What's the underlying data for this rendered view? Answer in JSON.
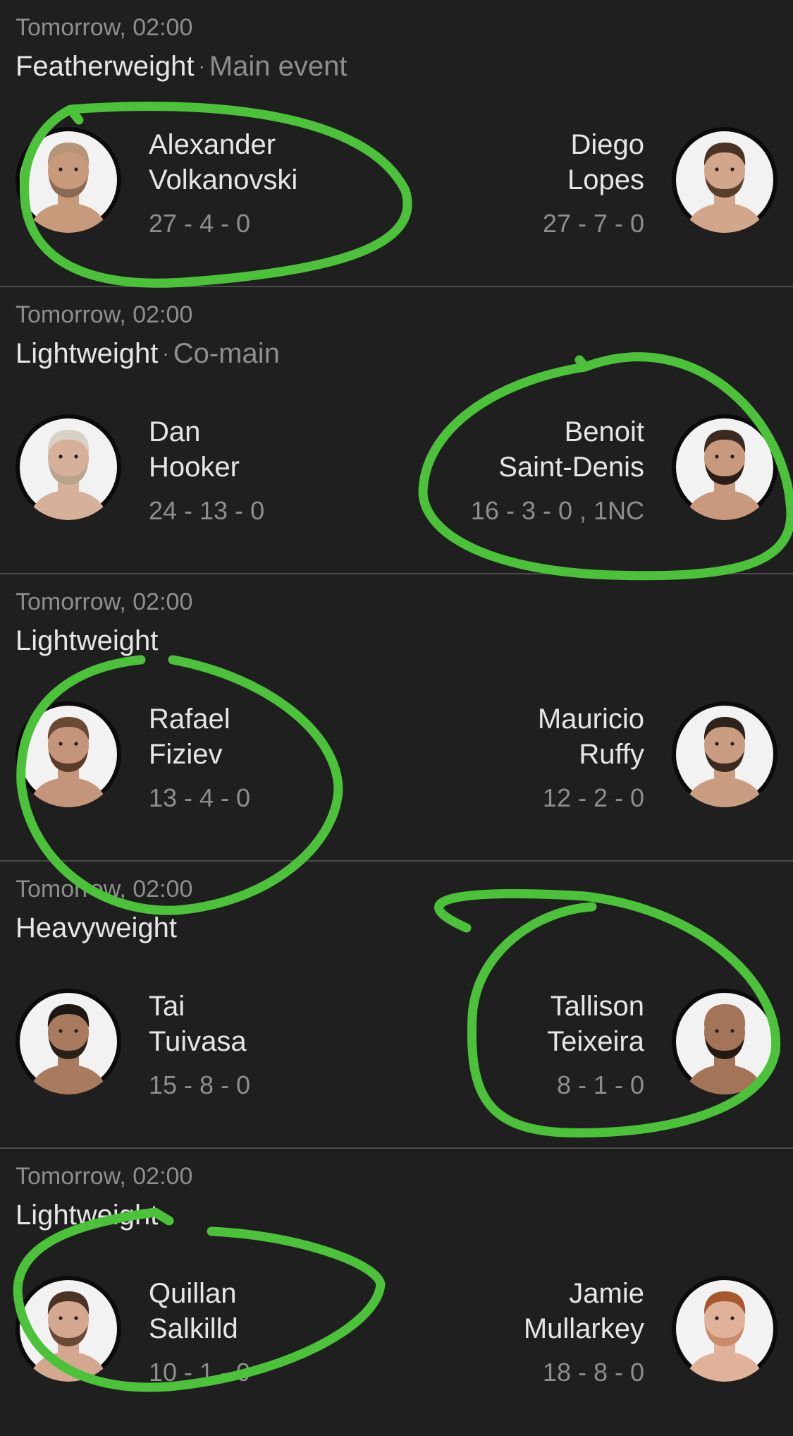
{
  "fights": [
    {
      "time": "Tomorrow, 02:00",
      "weight_class": "Featherweight",
      "separator": "·",
      "event_tag": "Main event",
      "left": {
        "first_name": "Alexander",
        "last_name": "Volkanovski",
        "record": "27 - 4 - 0",
        "skin": "#c89a7c",
        "hair": "#b59479",
        "beard": "#8a6a55"
      },
      "right": {
        "first_name": "Diego",
        "last_name": "Lopes",
        "record": "27 - 7 - 0",
        "skin": "#d2a68a",
        "hair": "#4a3325",
        "beard": "#5a3e2c"
      }
    },
    {
      "time": "Tomorrow, 02:00",
      "weight_class": "Lightweight",
      "separator": "·",
      "event_tag": "Co-main",
      "left": {
        "first_name": "Dan",
        "last_name": "Hooker",
        "record": "24 - 13 - 0",
        "skin": "#d6b09a",
        "hair": "#d8d2c6",
        "beard": "#b8a48c"
      },
      "right": {
        "first_name": "Benoit",
        "last_name": "Saint-Denis",
        "record": "16 - 3 - 0 , 1NC",
        "skin": "#c8997c",
        "hair": "#3a2a20",
        "beard": "#2a1e18"
      }
    },
    {
      "time": "Tomorrow, 02:00",
      "weight_class": "Lightweight",
      "separator": "",
      "event_tag": "",
      "left": {
        "first_name": "Rafael",
        "last_name": "Fiziev",
        "record": "13 - 4 - 0",
        "skin": "#c4957a",
        "hair": "#6a4a32",
        "beard": "#5a3c28"
      },
      "right": {
        "first_name": "Mauricio",
        "last_name": "Ruffy",
        "record": "12 - 2 - 0",
        "skin": "#c99d82",
        "hair": "#2e221a",
        "beard": "#3a2a20"
      }
    },
    {
      "time": "Tomorrow, 02:00",
      "weight_class": "Heavyweight",
      "separator": "",
      "event_tag": "",
      "left": {
        "first_name": "Tai",
        "last_name": "Tuivasa",
        "record": "15 - 8 - 0",
        "skin": "#a87a5e",
        "hair": "#1e1814",
        "beard": "#2a201a"
      },
      "right": {
        "first_name": "Tallison",
        "last_name": "Teixeira",
        "record": "8 - 1 - 0",
        "skin": "#a47458",
        "hair": "#a47458",
        "beard": "#241a14"
      }
    },
    {
      "time": "Tomorrow, 02:00",
      "weight_class": "Lightweight",
      "separator": "",
      "event_tag": "",
      "left": {
        "first_name": "Quillan",
        "last_name": "Salkilld",
        "record": "10 - 1 - 0",
        "skin": "#d4a890",
        "hair": "#4a3224",
        "beard": "#6a4a36"
      },
      "right": {
        "first_name": "Jamie",
        "last_name": "Mullarkey",
        "record": "18 - 8 - 0",
        "skin": "#e0b29a",
        "hair": "#a8582e",
        "beard": "#c88c6c"
      }
    }
  ],
  "annotation_color": "#4cc23a"
}
